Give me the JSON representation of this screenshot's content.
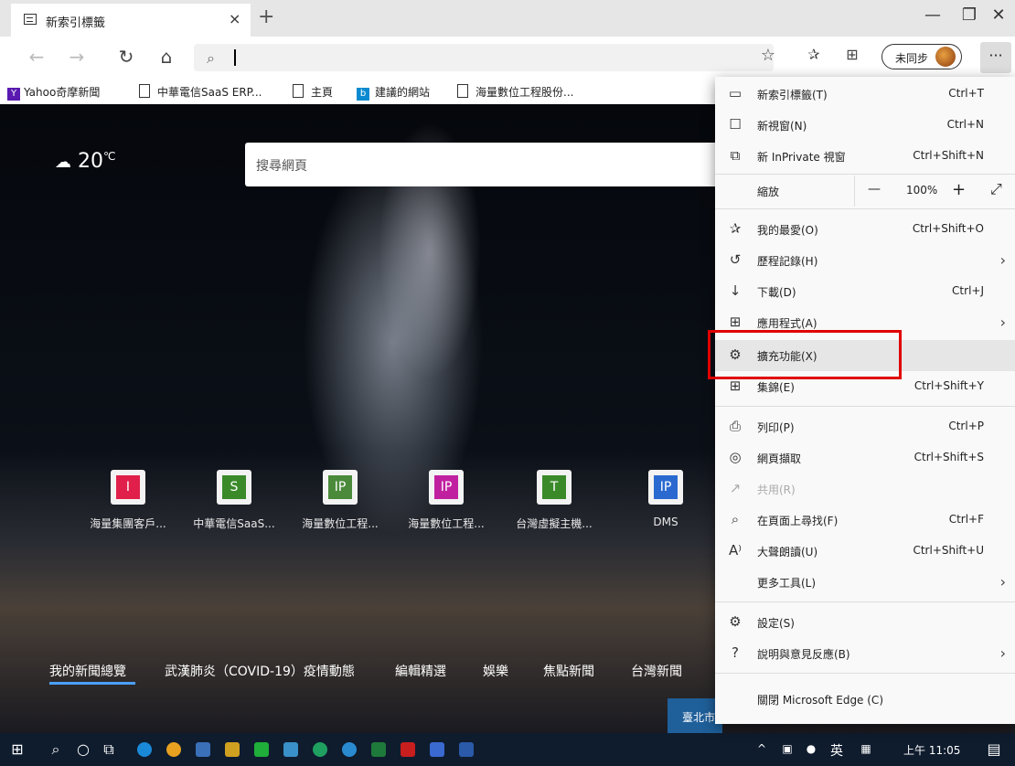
{
  "tab": {
    "title": "新索引標籤",
    "close": "×",
    "new": "+"
  },
  "window": {
    "minimize": "—",
    "restore": "❐",
    "close": "✕"
  },
  "toolbar": {
    "back": "←",
    "forward": "→",
    "refresh": "↻",
    "home": "⌂",
    "star": "☆",
    "favorites": "✰",
    "collections": "⊞",
    "sync_label": "未同步",
    "more": "···"
  },
  "favorites": [
    {
      "label": "Yahoo奇摩新聞",
      "icon": "yahoo-icon"
    },
    {
      "label": "中華電信SaaS ERP...",
      "icon": "page-icon"
    },
    {
      "label": "主頁",
      "icon": "page-icon"
    },
    {
      "label": "建議的網站",
      "icon": "bing-icon"
    },
    {
      "label": "海量數位工程股份...",
      "icon": "page-icon"
    }
  ],
  "weather": {
    "temp": "20",
    "unit": "℃"
  },
  "search": {
    "placeholder": "搜尋網頁"
  },
  "tiles": [
    {
      "letter": "I",
      "label": "海量集團客戶...",
      "color": "#e0204a"
    },
    {
      "letter": "S",
      "label": "中華電信SaaS...",
      "color": "#3a8a2a"
    },
    {
      "letter": "IP",
      "label": "海量數位工程...",
      "color": "#4a8a3a"
    },
    {
      "letter": "IP",
      "label": "海量數位工程...",
      "color": "#c020a0"
    },
    {
      "letter": "T",
      "label": "台灣虛擬主機...",
      "color": "#3a8a2a"
    },
    {
      "letter": "IP",
      "label": "DMS",
      "color": "#2a6ad0"
    }
  ],
  "news": [
    "我的新聞總覽",
    "武漢肺炎（COVID-19）疫情動態",
    "編輯精選",
    "娛樂",
    "焦點新聞",
    "台灣新聞"
  ],
  "weather_card": "臺北市",
  "menu": {
    "items": [
      {
        "icon": "tab-icon",
        "glyph": "▭",
        "label": "新索引標籤(T)",
        "shortcut": "Ctrl+T"
      },
      {
        "icon": "window-icon",
        "glyph": "☐",
        "label": "新視窗(N)",
        "shortcut": "Ctrl+N"
      },
      {
        "icon": "inprivate-icon",
        "glyph": "⧉",
        "label": "新 InPrivate 視窗",
        "shortcut": "Ctrl+Shift+N"
      }
    ],
    "zoom": {
      "label": "縮放",
      "minus": "—",
      "value": "100%",
      "plus": "+",
      "full": "⤢"
    },
    "items2": [
      {
        "icon": "favorites-icon",
        "glyph": "✰",
        "label": "我的最愛(O)",
        "shortcut": "Ctrl+Shift+O",
        "arrow": ""
      },
      {
        "icon": "history-icon",
        "glyph": "↺",
        "label": "歷程記錄(H)",
        "shortcut": "",
        "arrow": "›"
      },
      {
        "icon": "download-icon",
        "glyph": "↓",
        "label": "下載(D)",
        "shortcut": "Ctrl+J",
        "arrow": ""
      },
      {
        "icon": "apps-icon",
        "glyph": "⊞",
        "label": "應用程式(A)",
        "shortcut": "",
        "arrow": "›"
      },
      {
        "icon": "extensions-icon",
        "glyph": "⚙",
        "label": "擴充功能(X)",
        "shortcut": "",
        "arrow": ""
      },
      {
        "icon": "collections-icon",
        "glyph": "⊞",
        "label": "集錦(E)",
        "shortcut": "Ctrl+Shift+Y",
        "arrow": ""
      }
    ],
    "items3": [
      {
        "icon": "print-icon",
        "glyph": "⎙",
        "label": "列印(P)",
        "shortcut": "Ctrl+P",
        "arrow": ""
      },
      {
        "icon": "capture-icon",
        "glyph": "◎",
        "label": "網頁擷取",
        "shortcut": "Ctrl+Shift+S",
        "arrow": ""
      },
      {
        "icon": "share-icon",
        "glyph": "↗",
        "label": "共用(R)",
        "shortcut": "",
        "arrow": ""
      },
      {
        "icon": "find-icon",
        "glyph": "⌕",
        "label": "在頁面上尋找(F)",
        "shortcut": "Ctrl+F",
        "arrow": ""
      },
      {
        "icon": "read-aloud-icon",
        "glyph": "A⁾",
        "label": "大聲朗讀(U)",
        "shortcut": "Ctrl+Shift+U",
        "arrow": ""
      },
      {
        "icon": "more-tools-icon",
        "glyph": "",
        "label": "更多工具(L)",
        "shortcut": "",
        "arrow": "›"
      }
    ],
    "items4": [
      {
        "icon": "settings-icon",
        "glyph": "⚙",
        "label": "設定(S)",
        "shortcut": "",
        "arrow": ""
      },
      {
        "icon": "help-icon",
        "glyph": "?",
        "label": "說明與意見反應(B)",
        "shortcut": "",
        "arrow": "›"
      }
    ],
    "close_label": "關閉 Microsoft Edge (C)"
  },
  "taskbar": {
    "tray": "^",
    "lang": "英",
    "time": "上午 11:05"
  }
}
